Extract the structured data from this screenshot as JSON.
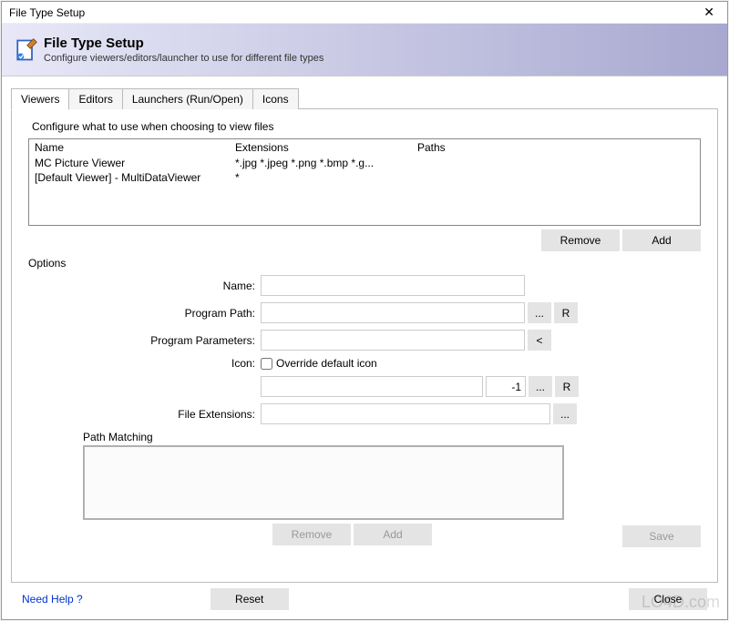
{
  "window": {
    "title": "File Type Setup"
  },
  "header": {
    "title": "File Type Setup",
    "subtitle": "Configure viewers/editors/launcher to use for different file types"
  },
  "tabs": [
    {
      "label": "Viewers"
    },
    {
      "label": "Editors"
    },
    {
      "label": "Launchers (Run/Open)"
    },
    {
      "label": "Icons"
    }
  ],
  "panel": {
    "description": "Configure what to use when choosing to view files"
  },
  "list": {
    "headers": {
      "name": "Name",
      "extensions": "Extensions",
      "paths": "Paths"
    },
    "rows": [
      {
        "name": "MC Picture Viewer",
        "extensions": "*.jpg *.jpeg *.png *.bmp *.g...",
        "paths": ""
      },
      {
        "name": "[Default Viewer] - MultiDataViewer",
        "extensions": "*",
        "paths": ""
      }
    ]
  },
  "buttons": {
    "remove": "Remove",
    "add": "Add",
    "save": "Save",
    "reset": "Reset",
    "close": "Close",
    "browse": "...",
    "r": "R",
    "lt": "<"
  },
  "options": {
    "section_label": "Options",
    "labels": {
      "name": "Name:",
      "program_path": "Program Path:",
      "program_parameters": "Program Parameters:",
      "icon": "Icon:",
      "override": "Override default icon",
      "file_extensions": "File Extensions:",
      "path_matching": "Path Matching"
    },
    "values": {
      "name": "",
      "program_path": "",
      "program_parameters": "",
      "icon_path": "",
      "icon_index": "-1",
      "file_extensions": ""
    }
  },
  "footer": {
    "help": "Need Help ?"
  },
  "watermark": "LO4D.com"
}
